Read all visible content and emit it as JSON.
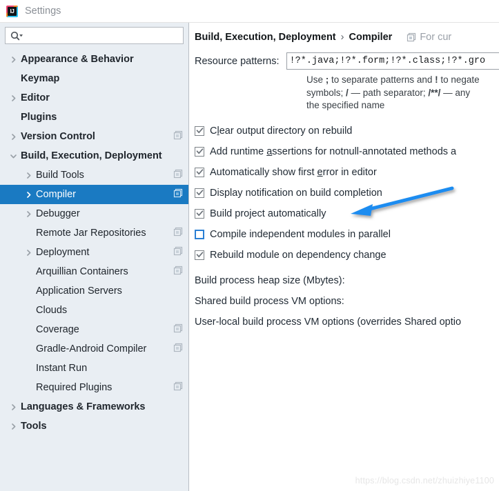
{
  "window": {
    "title": "Settings",
    "logo_text": "IJ",
    "logo_icon": "intellij-idea-logo"
  },
  "search": {
    "value": "",
    "placeholder": "",
    "icon": "search-icon",
    "dropdown_icon": "chevron-down-icon"
  },
  "sidebar": {
    "items": [
      {
        "label": "Appearance & Behavior",
        "level": 0,
        "twisty": "collapsed",
        "copy_icon": false,
        "selected": false
      },
      {
        "label": "Keymap",
        "level": 0,
        "twisty": "none",
        "copy_icon": false,
        "selected": false
      },
      {
        "label": "Editor",
        "level": 0,
        "twisty": "collapsed",
        "copy_icon": false,
        "selected": false
      },
      {
        "label": "Plugins",
        "level": 0,
        "twisty": "none",
        "copy_icon": false,
        "selected": false
      },
      {
        "label": "Version Control",
        "level": 0,
        "twisty": "collapsed",
        "copy_icon": true,
        "selected": false
      },
      {
        "label": "Build, Execution, Deployment",
        "level": 0,
        "twisty": "expanded",
        "copy_icon": false,
        "selected": false
      },
      {
        "label": "Build Tools",
        "level": 1,
        "twisty": "collapsed",
        "copy_icon": true,
        "selected": false
      },
      {
        "label": "Compiler",
        "level": 1,
        "twisty": "collapsed",
        "copy_icon": true,
        "selected": true
      },
      {
        "label": "Debugger",
        "level": 1,
        "twisty": "collapsed",
        "copy_icon": false,
        "selected": false
      },
      {
        "label": "Remote Jar Repositories",
        "level": 1,
        "twisty": "none",
        "copy_icon": true,
        "selected": false
      },
      {
        "label": "Deployment",
        "level": 1,
        "twisty": "collapsed",
        "copy_icon": true,
        "selected": false
      },
      {
        "label": "Arquillian Containers",
        "level": 1,
        "twisty": "none",
        "copy_icon": true,
        "selected": false
      },
      {
        "label": "Application Servers",
        "level": 1,
        "twisty": "none",
        "copy_icon": false,
        "selected": false
      },
      {
        "label": "Clouds",
        "level": 1,
        "twisty": "none",
        "copy_icon": false,
        "selected": false
      },
      {
        "label": "Coverage",
        "level": 1,
        "twisty": "none",
        "copy_icon": true,
        "selected": false
      },
      {
        "label": "Gradle-Android Compiler",
        "level": 1,
        "twisty": "none",
        "copy_icon": true,
        "selected": false
      },
      {
        "label": "Instant Run",
        "level": 1,
        "twisty": "none",
        "copy_icon": false,
        "selected": false
      },
      {
        "label": "Required Plugins",
        "level": 1,
        "twisty": "none",
        "copy_icon": true,
        "selected": false
      },
      {
        "label": "Languages & Frameworks",
        "level": 0,
        "twisty": "collapsed",
        "copy_icon": false,
        "selected": false
      },
      {
        "label": "Tools",
        "level": 0,
        "twisty": "collapsed",
        "copy_icon": false,
        "selected": false
      }
    ]
  },
  "panel": {
    "breadcrumb": {
      "parent": "Build, Execution, Deployment",
      "separator": "›",
      "current": "Compiler"
    },
    "scope_note": {
      "icon": "project-scope-icon",
      "label": "For cur"
    },
    "resource_patterns": {
      "label": "Resource patterns:",
      "value": "!?*.java;!?*.form;!?*.class;!?*.gro",
      "placeholder": ""
    },
    "hint": {
      "line1_a": "Use ",
      "line1_b": ";",
      "line1_c": " to separate patterns and ",
      "line1_d": "!",
      "line1_e": " to negate",
      "line2_a": "symbols; ",
      "line2_b": "/",
      "line2_c": " — path separator; ",
      "line2_d": "/**/",
      "line2_e": " — any",
      "line3": "the specified name"
    },
    "checkboxes": [
      {
        "pre": "C",
        "mnemonic": "l",
        "post": "ear output directory on rebuild",
        "checked": true
      },
      {
        "pre": "Add runtime ",
        "mnemonic": "a",
        "post": "ssertions for notnull-annotated methods a",
        "checked": true
      },
      {
        "pre": "Automatically show first ",
        "mnemonic": "e",
        "post": "rror in editor",
        "checked": true
      },
      {
        "pre": "Display notification on build completion",
        "mnemonic": "",
        "post": "",
        "checked": true
      },
      {
        "pre": "Build project automatically",
        "mnemonic": "",
        "post": "",
        "checked": true
      },
      {
        "pre": "Compile independent modules in parallel",
        "mnemonic": "",
        "post": "",
        "checked": false
      },
      {
        "pre": "Rebuild module on dependency change",
        "mnemonic": "",
        "post": "",
        "checked": true
      }
    ],
    "labels": [
      "Build process heap size (Mbytes):",
      "Shared build process VM options:",
      "User-local build process VM options (overrides Shared optio"
    ]
  },
  "annotation": {
    "type": "arrow",
    "color": "#1a8cf0",
    "points_at": "Build project automatically"
  },
  "watermark": {
    "text": "https://blog.csdn.net/zhuizhiye1100"
  },
  "colors": {
    "selection_blue": "#1a7ac2",
    "sidebar_bg": "#e9eef3",
    "panel_bg": "#ffffff",
    "accent_blue": "#2a7fd4"
  }
}
